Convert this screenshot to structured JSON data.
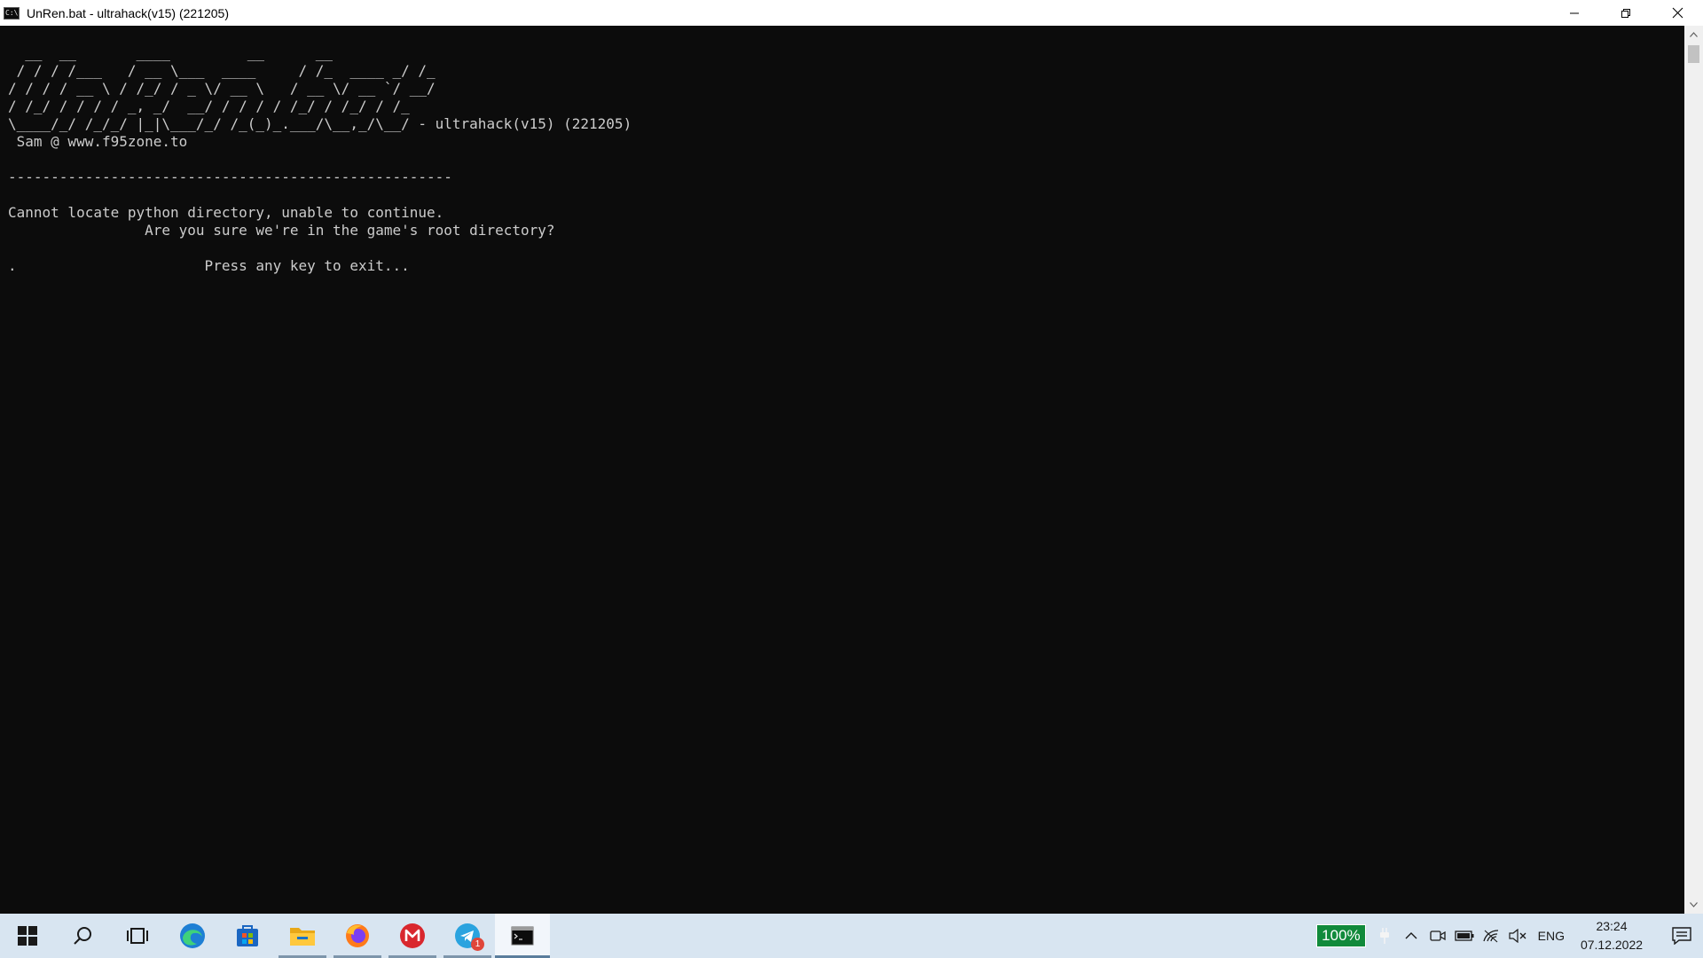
{
  "window": {
    "title": "UnRen.bat - ultrahack(v15) (221205)",
    "icon": "cmd-icon",
    "icon_text": "C:\\"
  },
  "console": {
    "lines": [
      "  __  __       ____         __      __",
      " / / / /___   / __ \\___  ____     / /_  ____ _/ /_",
      "/ / / / __ \\ / /_/ / _ \\/ __ \\   / __ \\/ __ `/ __/",
      "/ /_/ / / / / _, _/  __/ / / / / /_/ / /_/ / /_",
      "\\____/_/ /_/_/ |_|\\___/_/ /_(_)_.___/\\__,_/\\__/ - ultrahack(v15) (221205)",
      " Sam @ www.f95zone.to",
      "",
      "----------------------------------------------------",
      "",
      "Cannot locate python directory, unable to continue.",
      "                Are you sure we're in the game's root directory?",
      "",
      ".                      Press any key to exit..."
    ]
  },
  "taskbar": {
    "items": [
      {
        "name": "start-button",
        "icon": "windows-logo-icon"
      },
      {
        "name": "search-button",
        "icon": "search-icon"
      },
      {
        "name": "task-view-button",
        "icon": "task-view-icon"
      },
      {
        "name": "edge-button",
        "icon": "edge-icon"
      },
      {
        "name": "store-button",
        "icon": "store-icon"
      },
      {
        "name": "file-explorer-button",
        "icon": "folder-icon"
      },
      {
        "name": "firefox-button",
        "icon": "firefox-icon"
      },
      {
        "name": "mega-button",
        "icon": "mega-icon"
      },
      {
        "name": "telegram-button",
        "icon": "telegram-icon",
        "badge": "1"
      },
      {
        "name": "terminal-button",
        "icon": "terminal-icon"
      }
    ],
    "battery_percent": "100%",
    "language": "ENG",
    "time": "23:24",
    "date": "07.12.2022"
  },
  "colors": {
    "console_bg": "#0c0c0c",
    "console_fg": "#cccccc",
    "taskbar_bg": "#d8e5f1",
    "battery_bg": "#118a3b"
  }
}
